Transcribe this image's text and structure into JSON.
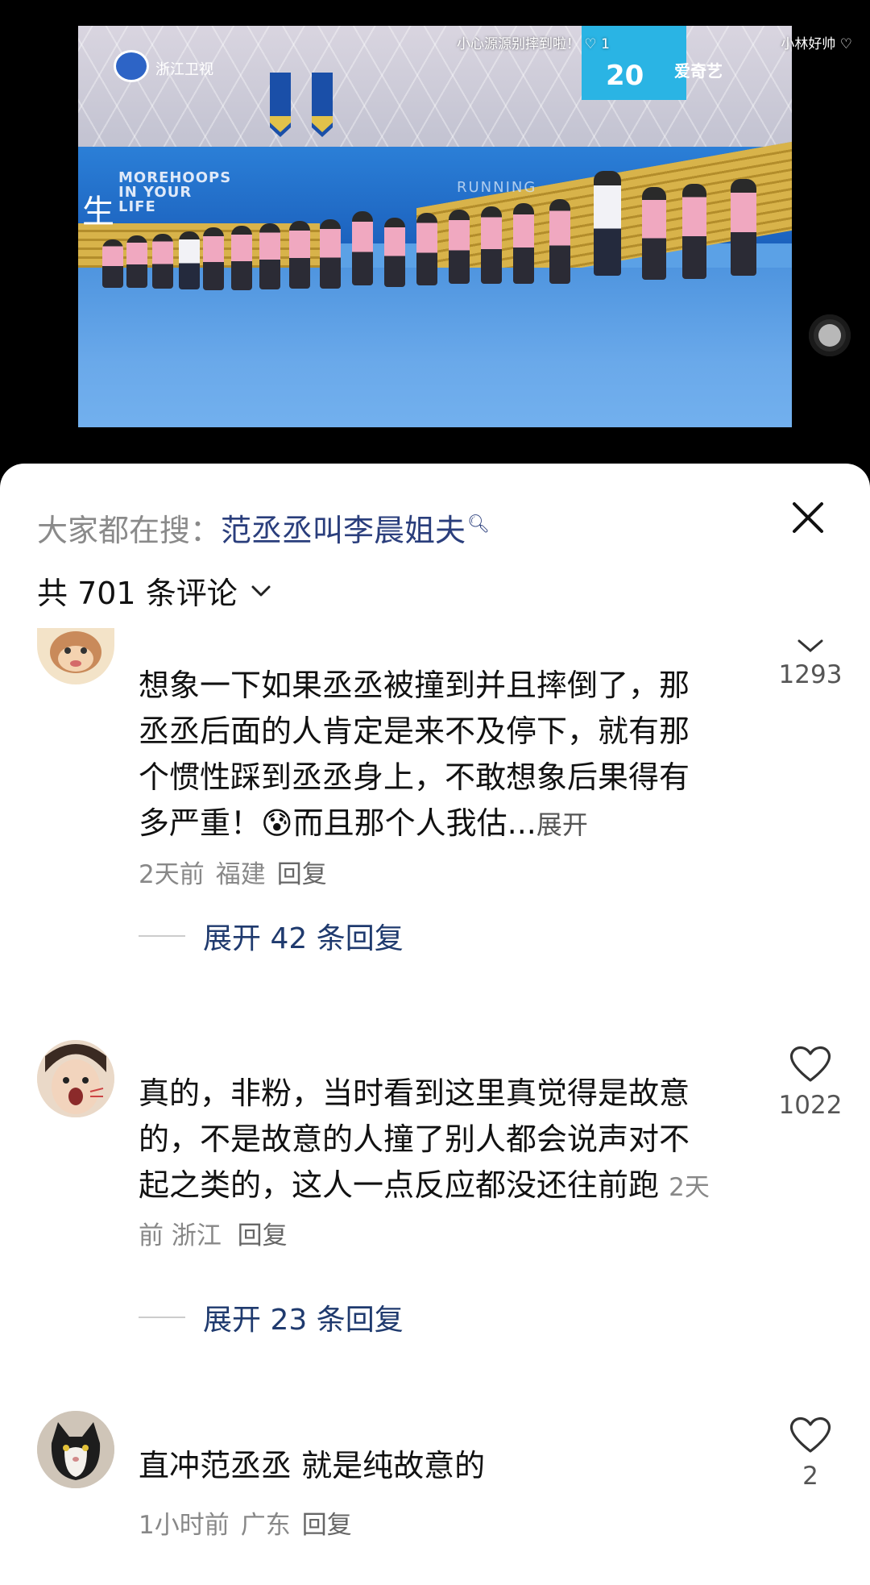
{
  "video": {
    "channel_logo_text": "浙江卫视",
    "caption": "小心源源别摔到啦！",
    "caption_likes": "1",
    "username": "小林好帅",
    "scoreboard": "20",
    "platform": "爱奇艺",
    "wall_text": "MOREHOOPS IN YOUR LIFE",
    "wall_char": "生",
    "wall_word": "RUNNING"
  },
  "sheet": {
    "search_prefix": "大家都在搜：",
    "search_query": "范丞丞叫李晨姐夫",
    "comment_count_label": "共 701 条评论"
  },
  "comments": [
    {
      "username": "",
      "text": "想象一下如果丞丞被撞到并且摔倒了，那丞丞后面的人肯定是来不及停下，就有那个惯性踩到丞丞身上，不敢想象后果得有多严重！",
      "emoji": "😰",
      "text_tail": "而且那个人我估...",
      "expand_label": "展开",
      "time": "2天前",
      "location": "福建",
      "reply_label": "回复",
      "likes": "1293",
      "expand_replies": "展开 42 条回复"
    },
    {
      "username": "",
      "text": "真的，非粉，当时看到这里真觉得是故意的，不是故意的人撞了别人都会说声对不起之类的，这人一点反应都没还往前跑",
      "time": "2天前",
      "location": "浙江",
      "reply_label": "回复",
      "likes": "1022",
      "expand_replies": "展开 23 条回复"
    },
    {
      "username": "",
      "text": "直冲范丞丞 就是纯故意的",
      "time": "1小时前",
      "location": "广东",
      "reply_label": "回复",
      "likes": "2"
    }
  ],
  "colors": {
    "query": "#2a3e7c",
    "expand_replies": "#1f3a6e",
    "meta": "#888888"
  }
}
